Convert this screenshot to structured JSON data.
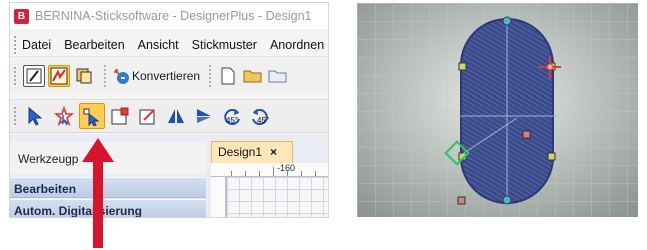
{
  "window": {
    "icon_letter": "B",
    "title": "BERNINA-Sticksoftware - DesignerPlus - Design1"
  },
  "menu": {
    "items": [
      "Datei",
      "Bearbeiten",
      "Ansicht",
      "Stickmuster",
      "Anordnen"
    ]
  },
  "toolbar1": {
    "buttons": [
      "brush-icon",
      "pattern-fill-icon",
      "pages-icon",
      "konvertieren-icon",
      "new-document-icon",
      "open-folder-icon",
      "open-folder-alt-icon"
    ],
    "konvertieren_label": "Konvertieren"
  },
  "toolbar2": {
    "buttons": [
      "select-arrow-icon",
      "select-star-icon",
      "reshape-tool-icon",
      "scale-box-icon",
      "scale-box-alt-icon",
      "mirror-vertical-icon",
      "mirror-horizontal-icon",
      "rotate-left-45-icon",
      "rotate-right-45-icon"
    ],
    "active_button": "reshape-tool-icon",
    "rotate_left_label": "45°",
    "rotate_right_label": "45°"
  },
  "side_panel": {
    "tab_label": "Werkzeugp",
    "sections": [
      "Bearbeiten",
      "Autom. Digitalisierung"
    ]
  },
  "document": {
    "tab_label": "Design1",
    "close_label": "×",
    "ruler_mark": "-160"
  },
  "colors": {
    "active_highlight": "#ffcc55",
    "panel_header": "#c6d4ea",
    "annotation_arrow": "#d8142d",
    "embroidery_fill": "#3a4a8a"
  }
}
